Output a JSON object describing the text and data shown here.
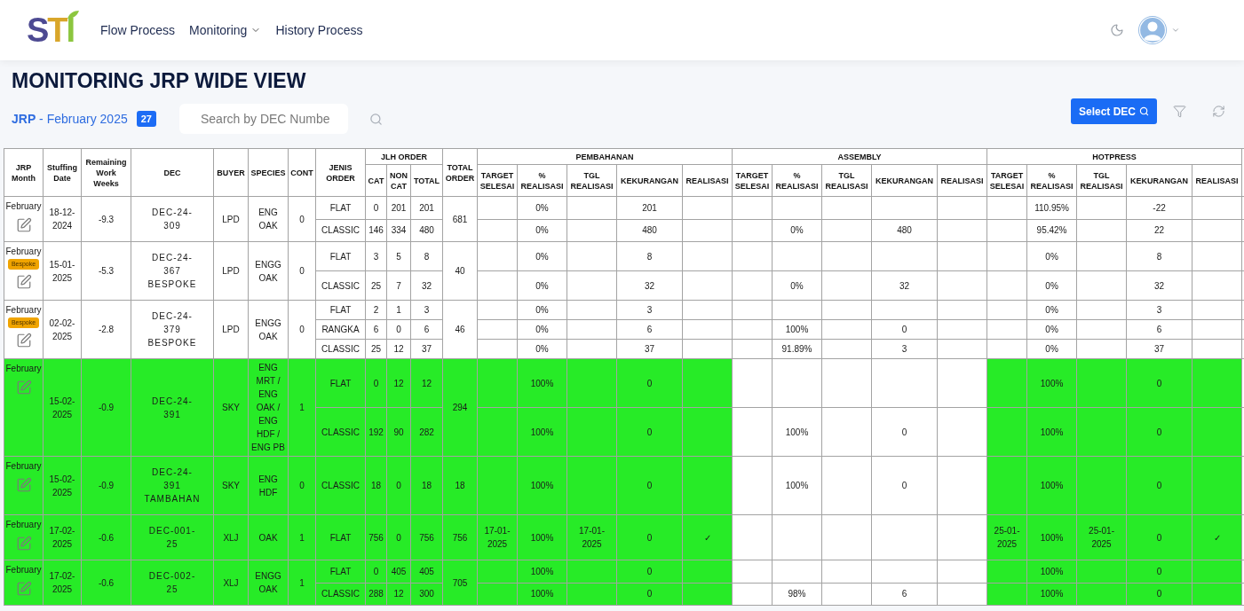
{
  "navbar": {
    "logo": "STI",
    "links": [
      {
        "label": "Flow Process",
        "dropdown": false
      },
      {
        "label": "Monitoring",
        "dropdown": true
      },
      {
        "label": "History Process",
        "dropdown": false
      }
    ]
  },
  "page": {
    "title": "MONITORING JRP WIDE VIEW",
    "period": "**JRP** - February 2025",
    "count": "27",
    "search": {
      "placeholder": "Search by DEC Numbe"
    },
    "select_button": "Select DEC"
  },
  "table": {
    "columns": [
      {
        "label": "JRP Month"
      },
      {
        "label": "Stuffing Date"
      },
      {
        "label": "Remaining Work Weeks"
      },
      {
        "label": "DEC"
      },
      {
        "label": "BUYER"
      },
      {
        "label": "SPECIES"
      },
      {
        "label": "CONT"
      },
      {
        "label": "JENIS ORDER"
      },
      {
        "label": "JLH ORDER",
        "children": [
          "CAT",
          "NON CAT",
          "TOTAL"
        ]
      },
      {
        "label": "TOTAL ORDER"
      }
    ],
    "stages": [
      {
        "label": "PEMBAHANAN",
        "columns": [
          "TARGET SELESAI",
          "% REALISASI",
          "TGL REALISASI",
          "KEKURANGAN",
          "REALISASI"
        ]
      },
      {
        "label": "ASSEMBLY",
        "columns": [
          "TARGET SELESAI",
          "% REALISASI",
          "TGL REALISASI",
          "KEKURANGAN",
          "REALISASI"
        ]
      },
      {
        "label": "HOTPRESS",
        "columns": [
          "TARGET SELESAI",
          "% REALISASI",
          "TGL REALISASI",
          "KEKURANGAN",
          "REALISASI"
        ]
      }
    ],
    "orders": [
      {
        "month": "February",
        "stuffing_date": "18-12-2024",
        "remaining_weeks": "-9.3",
        "dec": "DEC-24-309",
        "buyer": "LPD",
        "species": "ENG OAK",
        "cont": "0",
        "total_order": "681",
        "highlighted": false,
        "lines": [
          {
            "jenis_order": "FLAT",
            "cat": "0",
            "non_cat": "201",
            "total": "201",
            "stages": [
              {
                "highlighted": false,
                "pct_realisasi": "0%",
                "kekurangan": "201"
              },
              {
                "highlighted": false
              },
              {
                "highlighted": false,
                "pct_realisasi": "110.95%",
                "kekurangan": "-22"
              }
            ]
          },
          {
            "jenis_order": "CLASSIC",
            "cat": "146",
            "non_cat": "334",
            "total": "480",
            "stages": [
              {
                "highlighted": false,
                "pct_realisasi": "0%",
                "kekurangan": "480"
              },
              {
                "highlighted": false,
                "pct_realisasi": "0%",
                "kekurangan": "480"
              },
              {
                "highlighted": false,
                "pct_realisasi": "95.42%",
                "kekurangan": "22"
              }
            ]
          }
        ]
      },
      {
        "month": "February",
        "tag": "Bespoke",
        "stuffing_date": "15-01-2025",
        "remaining_weeks": "-5.3",
        "dec": "DEC-24-367 BESPOKE",
        "buyer": "LPD",
        "species": "ENGG OAK",
        "cont": "0",
        "total_order": "40",
        "highlighted": false,
        "lines": [
          {
            "jenis_order": "FLAT",
            "cat": "3",
            "non_cat": "5",
            "total": "8",
            "stages": [
              {
                "highlighted": false,
                "pct_realisasi": "0%",
                "kekurangan": "8"
              },
              {
                "highlighted": false
              },
              {
                "highlighted": false,
                "pct_realisasi": "0%",
                "kekurangan": "8"
              }
            ]
          },
          {
            "jenis_order": "CLASSIC",
            "cat": "25",
            "non_cat": "7",
            "total": "32",
            "stages": [
              {
                "highlighted": false,
                "pct_realisasi": "0%",
                "kekurangan": "32"
              },
              {
                "highlighted": false,
                "pct_realisasi": "0%",
                "kekurangan": "32"
              },
              {
                "highlighted": false,
                "pct_realisasi": "0%",
                "kekurangan": "32"
              }
            ]
          }
        ]
      },
      {
        "month": "February",
        "tag": "Bespoke",
        "stuffing_date": "02-02-2025",
        "remaining_weeks": "-2.8",
        "dec": "DEC-24-379 BESPOKE",
        "buyer": "LPD",
        "species": "ENGG OAK",
        "cont": "0",
        "total_order": "46",
        "highlighted": false,
        "lines": [
          {
            "jenis_order": "FLAT",
            "cat": "2",
            "non_cat": "1",
            "total": "3",
            "stages": [
              {
                "highlighted": false,
                "pct_realisasi": "0%",
                "kekurangan": "3"
              },
              {
                "highlighted": false
              },
              {
                "highlighted": false,
                "pct_realisasi": "0%",
                "kekurangan": "3"
              }
            ]
          },
          {
            "jenis_order": "RANGKA",
            "cat": "6",
            "non_cat": "0",
            "total": "6",
            "stages": [
              {
                "highlighted": false,
                "pct_realisasi": "0%",
                "kekurangan": "6"
              },
              {
                "highlighted": false,
                "pct_realisasi": "100%",
                "kekurangan": "0"
              },
              {
                "highlighted": false,
                "pct_realisasi": "0%",
                "kekurangan": "6"
              }
            ]
          },
          {
            "jenis_order": "CLASSIC",
            "cat": "25",
            "non_cat": "12",
            "total": "37",
            "stages": [
              {
                "highlighted": false,
                "pct_realisasi": "0%",
                "kekurangan": "37"
              },
              {
                "highlighted": false,
                "pct_realisasi": "91.89%",
                "kekurangan": "3"
              },
              {
                "highlighted": false,
                "pct_realisasi": "0%",
                "kekurangan": "37"
              }
            ]
          }
        ]
      },
      {
        "month": "February",
        "stuffing_date": "15-02-2025",
        "remaining_weeks": "-0.9",
        "dec": "DEC-24-391",
        "buyer": "SKY",
        "species": "ENG MRT / ENG OAK / ENG HDF / ENG PB",
        "cont": "1",
        "total_order": "294",
        "highlighted": true,
        "lines": [
          {
            "jenis_order": "FLAT",
            "cat": "0",
            "non_cat": "12",
            "total": "12",
            "stages": [
              {
                "highlighted": true,
                "pct_realisasi": "100%",
                "kekurangan": "0"
              },
              {
                "highlighted": false
              },
              {
                "highlighted": true,
                "pct_realisasi": "100%",
                "kekurangan": "0"
              }
            ]
          },
          {
            "jenis_order": "CLASSIC",
            "cat": "192",
            "non_cat": "90",
            "total": "282",
            "stages": [
              {
                "highlighted": true,
                "pct_realisasi": "100%",
                "kekurangan": "0"
              },
              {
                "highlighted": false,
                "pct_realisasi": "100%",
                "kekurangan": "0"
              },
              {
                "highlighted": true,
                "pct_realisasi": "100%",
                "kekurangan": "0"
              }
            ]
          }
        ]
      },
      {
        "month": "February",
        "stuffing_date": "15-02-2025",
        "remaining_weeks": "-0.9",
        "dec": "DEC-24-391 TAMBAHAN",
        "buyer": "SKY",
        "species": "ENG HDF",
        "cont": "0",
        "total_order": "18",
        "highlighted": true,
        "lines": [
          {
            "jenis_order": "CLASSIC",
            "cat": "18",
            "non_cat": "0",
            "total": "18",
            "stages": [
              {
                "highlighted": true,
                "pct_realisasi": "100%",
                "kekurangan": "0"
              },
              {
                "highlighted": false,
                "pct_realisasi": "100%",
                "kekurangan": "0"
              },
              {
                "highlighted": true,
                "pct_realisasi": "100%",
                "kekurangan": "0"
              }
            ]
          }
        ]
      },
      {
        "month": "February",
        "stuffing_date": "17-02-2025",
        "remaining_weeks": "-0.6",
        "dec": "DEC-001-25",
        "buyer": "XLJ",
        "species": "OAK",
        "cont": "1",
        "total_order": "756",
        "highlighted": true,
        "lines": [
          {
            "jenis_order": "FLAT",
            "cat": "756",
            "non_cat": "0",
            "total": "756",
            "stages": [
              {
                "highlighted": true,
                "target_selesai": "17-01-2025",
                "pct_realisasi": "100%",
                "tgl_realisasi": "17-01-2025",
                "kekurangan": "0",
                "realisasi": "✓"
              },
              {
                "highlighted": false
              },
              {
                "highlighted": true,
                "target_selesai": "25-01-2025",
                "pct_realisasi": "100%",
                "tgl_realisasi": "25-01-2025",
                "kekurangan": "0",
                "realisasi": "✓"
              }
            ]
          }
        ]
      },
      {
        "month": "February",
        "stuffing_date": "17-02-2025",
        "remaining_weeks": "-0.6",
        "dec": "DEC-002-25",
        "buyer": "XLJ",
        "species": "ENGG OAK",
        "cont": "1",
        "total_order": "705",
        "highlighted": true,
        "lines": [
          {
            "jenis_order": "FLAT",
            "cat": "0",
            "non_cat": "405",
            "total": "405",
            "stages": [
              {
                "highlighted": true,
                "pct_realisasi": "100%",
                "kekurangan": "0"
              },
              {
                "highlighted": false
              },
              {
                "highlighted": true,
                "pct_realisasi": "100%",
                "kekurangan": "0"
              }
            ]
          },
          {
            "jenis_order": "CLASSIC",
            "cat": "288",
            "non_cat": "12",
            "total": "300",
            "stages": [
              {
                "highlighted": true,
                "pct_realisasi": "100%",
                "kekurangan": "0"
              },
              {
                "highlighted": false,
                "pct_realisasi": "98%",
                "kekurangan": "6"
              },
              {
                "highlighted": true,
                "pct_realisasi": "100%",
                "kekurangan": "0"
              }
            ]
          }
        ]
      }
    ]
  }
}
